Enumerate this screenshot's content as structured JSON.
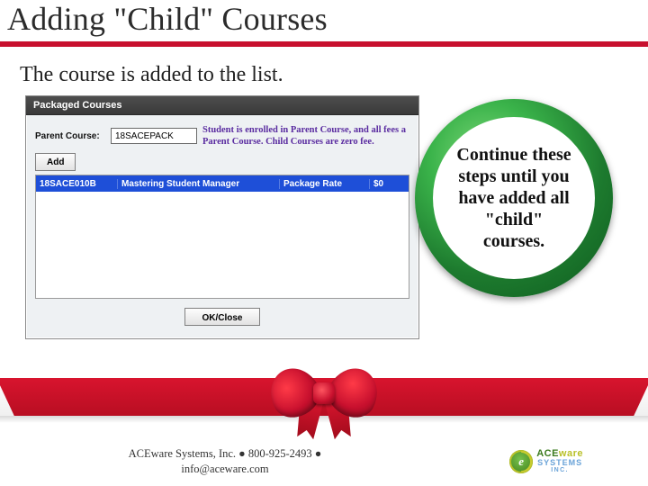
{
  "title": "Adding \"Child\" Courses",
  "subhead": "The course is added to the list.",
  "dialog": {
    "title": "Packaged Courses",
    "parent_label": "Parent Course:",
    "parent_value": "18SACEPACK",
    "info_line1": "Student is enrolled in Parent Course, and all fees a",
    "info_line2": "Parent Course. Child Courses are zero fee.",
    "add_label": "Add",
    "row": {
      "code": "18SACE010B",
      "name": "Mastering Student Manager",
      "rate_label": "Package Rate",
      "price": "$0"
    },
    "ok_label": "OK/Close"
  },
  "callout": "Continue these steps until you have added all \"child\" courses.",
  "footer": {
    "line1": "ACEware Systems, Inc. ● 800-925-2493 ●",
    "line2": "info@aceware.com"
  },
  "logo": {
    "segments": {
      "ace": "ACE",
      "ware": "ware"
    },
    "line2": "SYSTEMS",
    "line3": "INC.",
    "mark_letter": "e"
  }
}
